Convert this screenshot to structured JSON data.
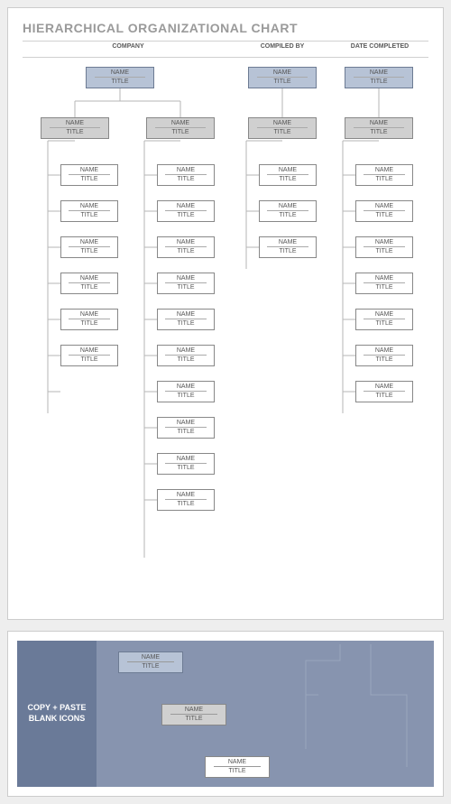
{
  "title": "HIERARCHICAL ORGANIZATIONAL CHART",
  "headers": {
    "company": "COMPANY",
    "compiled_by": "COMPILED BY",
    "date_completed": "DATE COMPLETED"
  },
  "node_label": {
    "name": "NAME",
    "title": "TITLE"
  },
  "top_nodes": [
    {
      "id": "top-a",
      "name": "NAME",
      "title": "TITLE"
    },
    {
      "id": "top-b",
      "name": "NAME",
      "title": "TITLE"
    },
    {
      "id": "top-c",
      "name": "NAME",
      "title": "TITLE"
    },
    {
      "id": "top-d",
      "name": "NAME",
      "title": "TITLE"
    }
  ],
  "columns": {
    "col_a": [
      {
        "name": "NAME",
        "title": "TITLE"
      },
      {
        "name": "NAME",
        "title": "TITLE"
      },
      {
        "name": "NAME",
        "title": "TITLE"
      },
      {
        "name": "NAME",
        "title": "TITLE"
      },
      {
        "name": "NAME",
        "title": "TITLE"
      },
      {
        "name": "NAME",
        "title": "TITLE"
      }
    ],
    "col_b": [
      {
        "name": "NAME",
        "title": "TITLE"
      },
      {
        "name": "NAME",
        "title": "TITLE"
      },
      {
        "name": "NAME",
        "title": "TITLE"
      },
      {
        "name": "NAME",
        "title": "TITLE"
      },
      {
        "name": "NAME",
        "title": "TITLE"
      },
      {
        "name": "NAME",
        "title": "TITLE"
      },
      {
        "name": "NAME",
        "title": "TITLE"
      },
      {
        "name": "NAME",
        "title": "TITLE"
      },
      {
        "name": "NAME",
        "title": "TITLE"
      },
      {
        "name": "NAME",
        "title": "TITLE"
      }
    ],
    "col_c": [
      {
        "name": "NAME",
        "title": "TITLE"
      },
      {
        "name": "NAME",
        "title": "TITLE"
      },
      {
        "name": "NAME",
        "title": "TITLE"
      }
    ],
    "col_d": [
      {
        "name": "NAME",
        "title": "TITLE"
      },
      {
        "name": "NAME",
        "title": "TITLE"
      },
      {
        "name": "NAME",
        "title": "TITLE"
      },
      {
        "name": "NAME",
        "title": "TITLE"
      },
      {
        "name": "NAME",
        "title": "TITLE"
      },
      {
        "name": "NAME",
        "title": "TITLE"
      },
      {
        "name": "NAME",
        "title": "TITLE"
      }
    ]
  },
  "copy_panel": {
    "label": "COPY + PASTE BLANK ICONS",
    "shapes": [
      {
        "variant": "blue",
        "name": "NAME",
        "title": "TITLE"
      },
      {
        "variant": "grey",
        "name": "NAME",
        "title": "TITLE"
      },
      {
        "variant": "white",
        "name": "NAME",
        "title": "TITLE"
      }
    ]
  }
}
